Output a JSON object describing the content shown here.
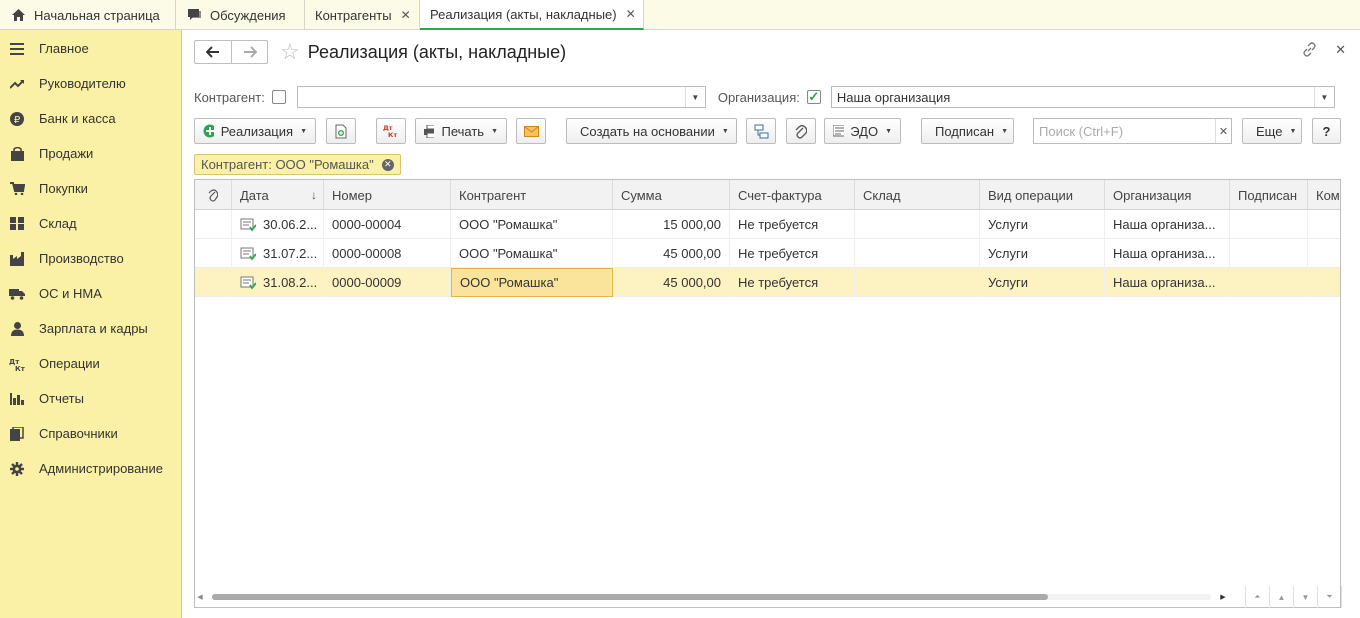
{
  "tabs": [
    {
      "label": "Начальная страница",
      "icon": "home-icon",
      "closable": false
    },
    {
      "label": "Обсуждения",
      "icon": "chat-icon",
      "closable": false
    },
    {
      "label": "Контрагенты",
      "closable": true
    },
    {
      "label": "Реализация (акты, накладные)",
      "closable": true,
      "active": true
    }
  ],
  "sidebar": {
    "items": [
      {
        "label": "Главное",
        "icon": "menu-icon"
      },
      {
        "label": "Руководителю",
        "icon": "trend-icon"
      },
      {
        "label": "Банк и касса",
        "icon": "ruble-icon"
      },
      {
        "label": "Продажи",
        "icon": "bag-icon"
      },
      {
        "label": "Покупки",
        "icon": "cart-icon"
      },
      {
        "label": "Склад",
        "icon": "warehouse-icon"
      },
      {
        "label": "Производство",
        "icon": "factory-icon"
      },
      {
        "label": "ОС и НМА",
        "icon": "truck-icon"
      },
      {
        "label": "Зарплата и кадры",
        "icon": "person-icon"
      },
      {
        "label": "Операции",
        "icon": "dt-kt-icon"
      },
      {
        "label": "Отчеты",
        "icon": "chart-icon"
      },
      {
        "label": "Справочники",
        "icon": "books-icon"
      },
      {
        "label": "Администрирование",
        "icon": "gear-icon"
      }
    ]
  },
  "header": {
    "title": "Реализация (акты, накладные)"
  },
  "filters": {
    "kontragent_label": "Контрагент:",
    "kontragent_value": "",
    "org_label": "Организация:",
    "org_value": "Наша организация"
  },
  "toolbar": {
    "create_label": "Реализация",
    "print_label": "Печать",
    "create_basis_label": "Создать на основании",
    "edo_label": "ЭДО",
    "signed_label": "Подписан",
    "search_placeholder": "Поиск (Ctrl+F)",
    "more_label": "Еще",
    "help_label": "?",
    "dtkt_label": "Дт Кт"
  },
  "active_filter": "Контрагент: ООО \"Ромашка\"",
  "table": {
    "columns": [
      "Дата",
      "Номер",
      "Контрагент",
      "Сумма",
      "Счет-фактура",
      "Склад",
      "Вид операции",
      "Организация",
      "Подписан",
      "Ком"
    ],
    "rows": [
      {
        "date": "30.06.2...",
        "number": "0000-00004",
        "kontragent": "ООО \"Ромашка\"",
        "sum": "15 000,00",
        "invoice": "Не требуется",
        "sklad": "",
        "op": "Услуги",
        "org": "Наша организа...",
        "signed": "",
        "com": ""
      },
      {
        "date": "31.07.2...",
        "number": "0000-00008",
        "kontragent": "ООО \"Ромашка\"",
        "sum": "45 000,00",
        "invoice": "Не требуется",
        "sklad": "",
        "op": "Услуги",
        "org": "Наша организа...",
        "signed": "",
        "com": ""
      },
      {
        "date": "31.08.2...",
        "number": "0000-00009",
        "kontragent": "ООО \"Ромашка\"",
        "sum": "45 000,00",
        "invoice": "Не требуется",
        "sklad": "",
        "op": "Услуги",
        "org": "Наша организа...",
        "signed": "",
        "com": "",
        "selected": true
      }
    ]
  },
  "colors": {
    "sidebar_bg": "#fbf1a6",
    "active_tab_accent": "#2ea44f",
    "selected_row": "#fcf2c2",
    "focused_cell": "#fae49c"
  }
}
